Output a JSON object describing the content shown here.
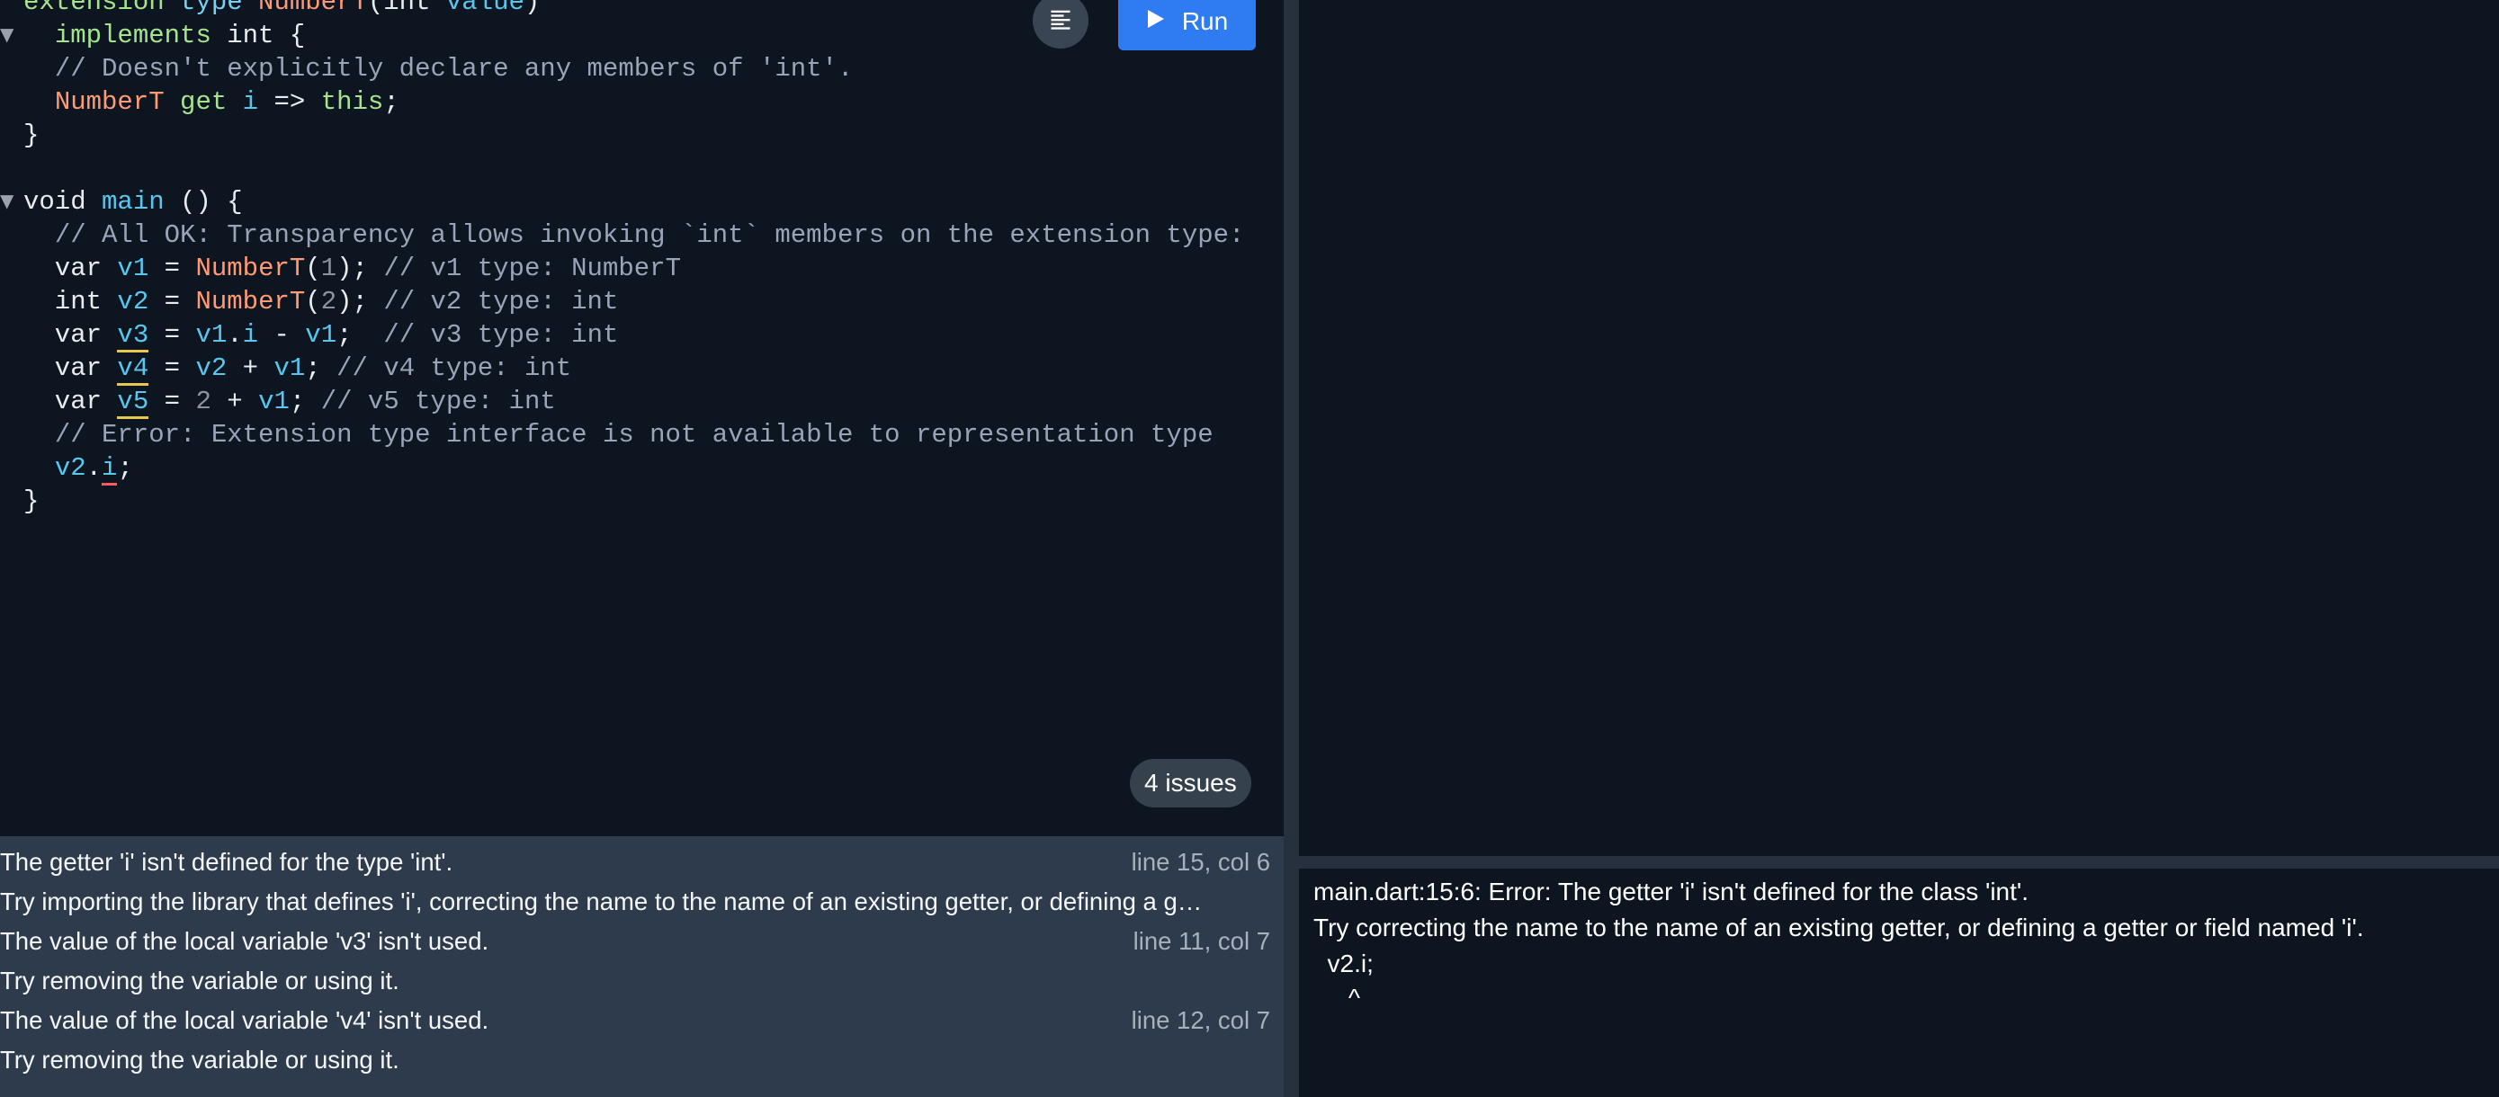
{
  "toolbar": {
    "run_label": "Run",
    "run_icon": "play-icon",
    "format_icon": "format-align-icon"
  },
  "code_lines": [
    {
      "fold": "",
      "tokens": [
        [
          "kw2",
          "extension "
        ],
        [
          "kw",
          "type "
        ],
        [
          "type",
          "NumberT"
        ],
        [
          "plain",
          "(int "
        ],
        [
          "var",
          "value"
        ],
        [
          "plain",
          ")"
        ]
      ]
    },
    {
      "fold": "▼",
      "tokens": [
        [
          "plain",
          "  "
        ],
        [
          "kw2",
          "implements"
        ],
        [
          "plain",
          " int {"
        ]
      ]
    },
    {
      "fold": "",
      "tokens": [
        [
          "plain",
          "  "
        ],
        [
          "com",
          "// Doesn't explicitly declare any members of 'int'."
        ]
      ]
    },
    {
      "fold": "",
      "tokens": [
        [
          "plain",
          "  "
        ],
        [
          "type",
          "NumberT"
        ],
        [
          "plain",
          " "
        ],
        [
          "kw2",
          "get"
        ],
        [
          "plain",
          " "
        ],
        [
          "fn",
          "i"
        ],
        [
          "plain",
          " => "
        ],
        [
          "kw2",
          "this"
        ],
        [
          "plain",
          ";"
        ]
      ]
    },
    {
      "fold": "",
      "tokens": [
        [
          "plain",
          "}"
        ]
      ]
    },
    {
      "fold": "",
      "tokens": []
    },
    {
      "fold": "▼",
      "tokens": [
        [
          "plain",
          "void "
        ],
        [
          "fn",
          "main"
        ],
        [
          "plain",
          " () {"
        ]
      ]
    },
    {
      "fold": "",
      "tokens": [
        [
          "plain",
          "  "
        ],
        [
          "com",
          "// All OK: Transparency allows invoking `int` members on the extension type:"
        ]
      ]
    },
    {
      "fold": "",
      "tokens": [
        [
          "plain",
          "  var "
        ],
        [
          "var",
          "v1"
        ],
        [
          "plain",
          " = "
        ],
        [
          "type",
          "NumberT"
        ],
        [
          "plain",
          "("
        ],
        [
          "num",
          "1"
        ],
        [
          "plain",
          "); "
        ],
        [
          "com",
          "// v1 type: NumberT"
        ]
      ]
    },
    {
      "fold": "",
      "tokens": [
        [
          "plain",
          "  int "
        ],
        [
          "var",
          "v2"
        ],
        [
          "plain",
          " = "
        ],
        [
          "type",
          "NumberT"
        ],
        [
          "plain",
          "("
        ],
        [
          "num",
          "2"
        ],
        [
          "plain",
          "); "
        ],
        [
          "com",
          "// v2 type: int"
        ]
      ]
    },
    {
      "fold": "",
      "tokens": [
        [
          "plain",
          "  var "
        ],
        [
          "var",
          "v3",
          "warn"
        ],
        [
          "plain",
          " = "
        ],
        [
          "var",
          "v1"
        ],
        [
          "plain",
          "."
        ],
        [
          "var",
          "i"
        ],
        [
          "plain",
          " - "
        ],
        [
          "var",
          "v1"
        ],
        [
          "plain",
          ";  "
        ],
        [
          "com",
          "// v3 type: int"
        ]
      ]
    },
    {
      "fold": "",
      "tokens": [
        [
          "plain",
          "  var "
        ],
        [
          "var",
          "v4",
          "warn"
        ],
        [
          "plain",
          " = "
        ],
        [
          "var",
          "v2"
        ],
        [
          "plain",
          " + "
        ],
        [
          "var",
          "v1"
        ],
        [
          "plain",
          "; "
        ],
        [
          "com",
          "// v4 type: int"
        ]
      ]
    },
    {
      "fold": "",
      "tokens": [
        [
          "plain",
          "  var "
        ],
        [
          "var",
          "v5",
          "warn"
        ],
        [
          "plain",
          " = "
        ],
        [
          "num",
          "2"
        ],
        [
          "plain",
          " + "
        ],
        [
          "var",
          "v1"
        ],
        [
          "plain",
          "; "
        ],
        [
          "com",
          "// v5 type: int"
        ]
      ]
    },
    {
      "fold": "",
      "tokens": [
        [
          "plain",
          "  "
        ],
        [
          "com",
          "// Error: Extension type interface is not available to representation type"
        ]
      ]
    },
    {
      "fold": "",
      "tokens": [
        [
          "plain",
          "  "
        ],
        [
          "var",
          "v2"
        ],
        [
          "plain",
          "."
        ],
        [
          "var",
          "i",
          "err"
        ],
        [
          "plain",
          ";"
        ]
      ]
    },
    {
      "fold": "",
      "tokens": [
        [
          "plain",
          "}"
        ]
      ]
    }
  ],
  "issues_badge": "4 issues",
  "problems": [
    {
      "message": "The getter 'i' isn't defined for the type 'int'.",
      "location": "line 15, col 6"
    },
    {
      "message": "Try importing the library that defines 'i', correcting the name to the name of an existing getter, or defining a g…",
      "location": ""
    },
    {
      "message": "The value of the local variable 'v3' isn't used.",
      "location": "line 11, col 7"
    },
    {
      "message": "Try removing the variable or using it.",
      "location": ""
    },
    {
      "message": "The value of the local variable 'v4' isn't used.",
      "location": "line 12, col 7"
    },
    {
      "message": "Try removing the variable or using it.",
      "location": ""
    }
  ],
  "console_lines": [
    "main.dart:15:6: Error: The getter 'i' isn't defined for the class 'int'.",
    "Try correcting the name to the name of an existing getter, or defining a getter or field named 'i'.",
    "  v2.i;",
    "     ^"
  ],
  "colors": {
    "run_button": "#2f7cf2",
    "editor_bg": "#0d1520",
    "problems_bg": "#2e3b4c",
    "warning_underline": "#e6c84d",
    "error_underline": "#ff5b5b"
  }
}
